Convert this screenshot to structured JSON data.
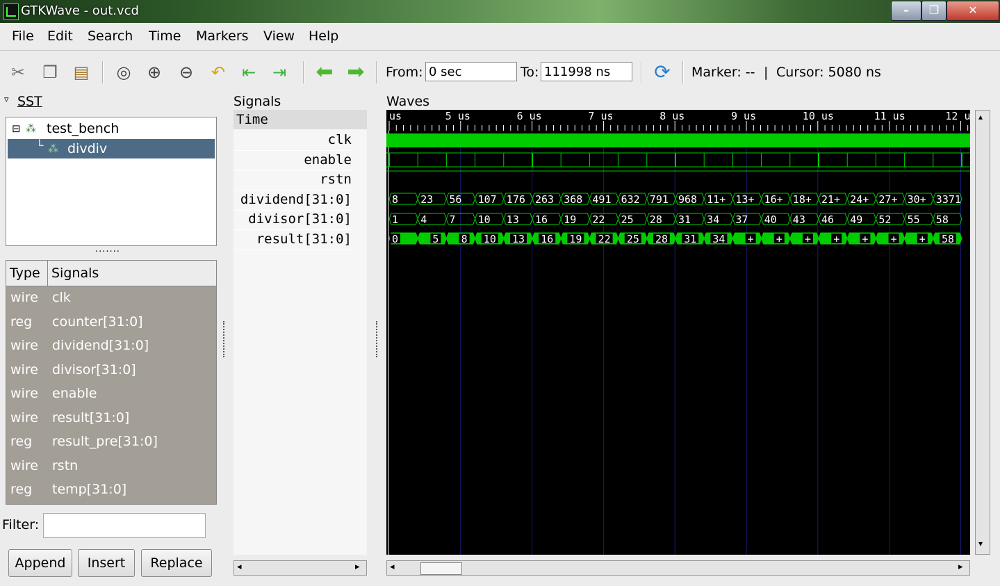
{
  "window": {
    "title": "GTKWave - out.vcd",
    "minimize": "–",
    "maximize": "❐",
    "close": "✕"
  },
  "menu": [
    "File",
    "Edit",
    "Search",
    "Time",
    "Markers",
    "View",
    "Help"
  ],
  "toolbar": {
    "icons": [
      "cut-icon",
      "copy-icon",
      "paste-icon",
      "zoom-fit-icon",
      "zoom-in-icon",
      "zoom-out-icon",
      "undo-zoom-icon",
      "jump-start-icon",
      "jump-end-icon",
      "prev-edge-icon",
      "next-edge-icon",
      "reload-icon"
    ],
    "from_label": "From:",
    "from_value": "0 sec",
    "to_label": "To:",
    "to_value": "111998 ns",
    "marker": "Marker: --",
    "separator": "|",
    "cursor": "Cursor: 5080 ns"
  },
  "sst": {
    "label": "SST",
    "tree": [
      {
        "name": "test_bench",
        "expanded": true
      },
      {
        "name": "divdiv",
        "selected": true
      }
    ],
    "grip": ".......",
    "table_headers": [
      "Type",
      "Signals"
    ],
    "rows": [
      {
        "type": "wire",
        "name": "clk"
      },
      {
        "type": "reg",
        "name": "counter[31:0]"
      },
      {
        "type": "wire",
        "name": "dividend[31:0]"
      },
      {
        "type": "wire",
        "name": "divisor[31:0]"
      },
      {
        "type": "wire",
        "name": "enable"
      },
      {
        "type": "wire",
        "name": "result[31:0]"
      },
      {
        "type": "reg",
        "name": "result_pre[31:0]"
      },
      {
        "type": "wire",
        "name": "rstn"
      },
      {
        "type": "reg",
        "name": "temp[31:0]"
      }
    ],
    "filter_label": "Filter:",
    "filter_value": "",
    "buttons": {
      "append": "Append",
      "insert": "Insert",
      "replace": "Replace"
    }
  },
  "signals": {
    "label": "Signals",
    "time_header": "Time",
    "names": [
      "clk",
      "enable",
      "rstn",
      "dividend[31:0]",
      "divisor[31:0]",
      "result[31:0]"
    ]
  },
  "waves": {
    "label": "Waves",
    "tick_labels": [
      "us",
      "5 us",
      "6 us",
      "7 us",
      "8 us",
      "9 us",
      "10 us",
      "11 us",
      "12 u"
    ],
    "dividend": [
      "8",
      "23",
      "56",
      "107",
      "176",
      "263",
      "368",
      "491",
      "632",
      "791",
      "968",
      "11+",
      "13+",
      "16+",
      "18+",
      "21+",
      "24+",
      "27+",
      "30+",
      "3371"
    ],
    "divisor": [
      "1",
      "4",
      "7",
      "10",
      "13",
      "16",
      "19",
      "22",
      "25",
      "28",
      "31",
      "34",
      "37",
      "40",
      "43",
      "46",
      "49",
      "52",
      "55",
      "58"
    ],
    "result": [
      "0",
      "5",
      "8",
      "10",
      "13",
      "16",
      "19",
      "22",
      "25",
      "28",
      "31",
      "34",
      "+",
      "+",
      "+",
      "+",
      "+",
      "+",
      "+",
      "58"
    ],
    "colors": {
      "wave": "#00cc00",
      "grid": "#1a1a7a",
      "background": "#000000",
      "text": "#ffffff"
    }
  }
}
